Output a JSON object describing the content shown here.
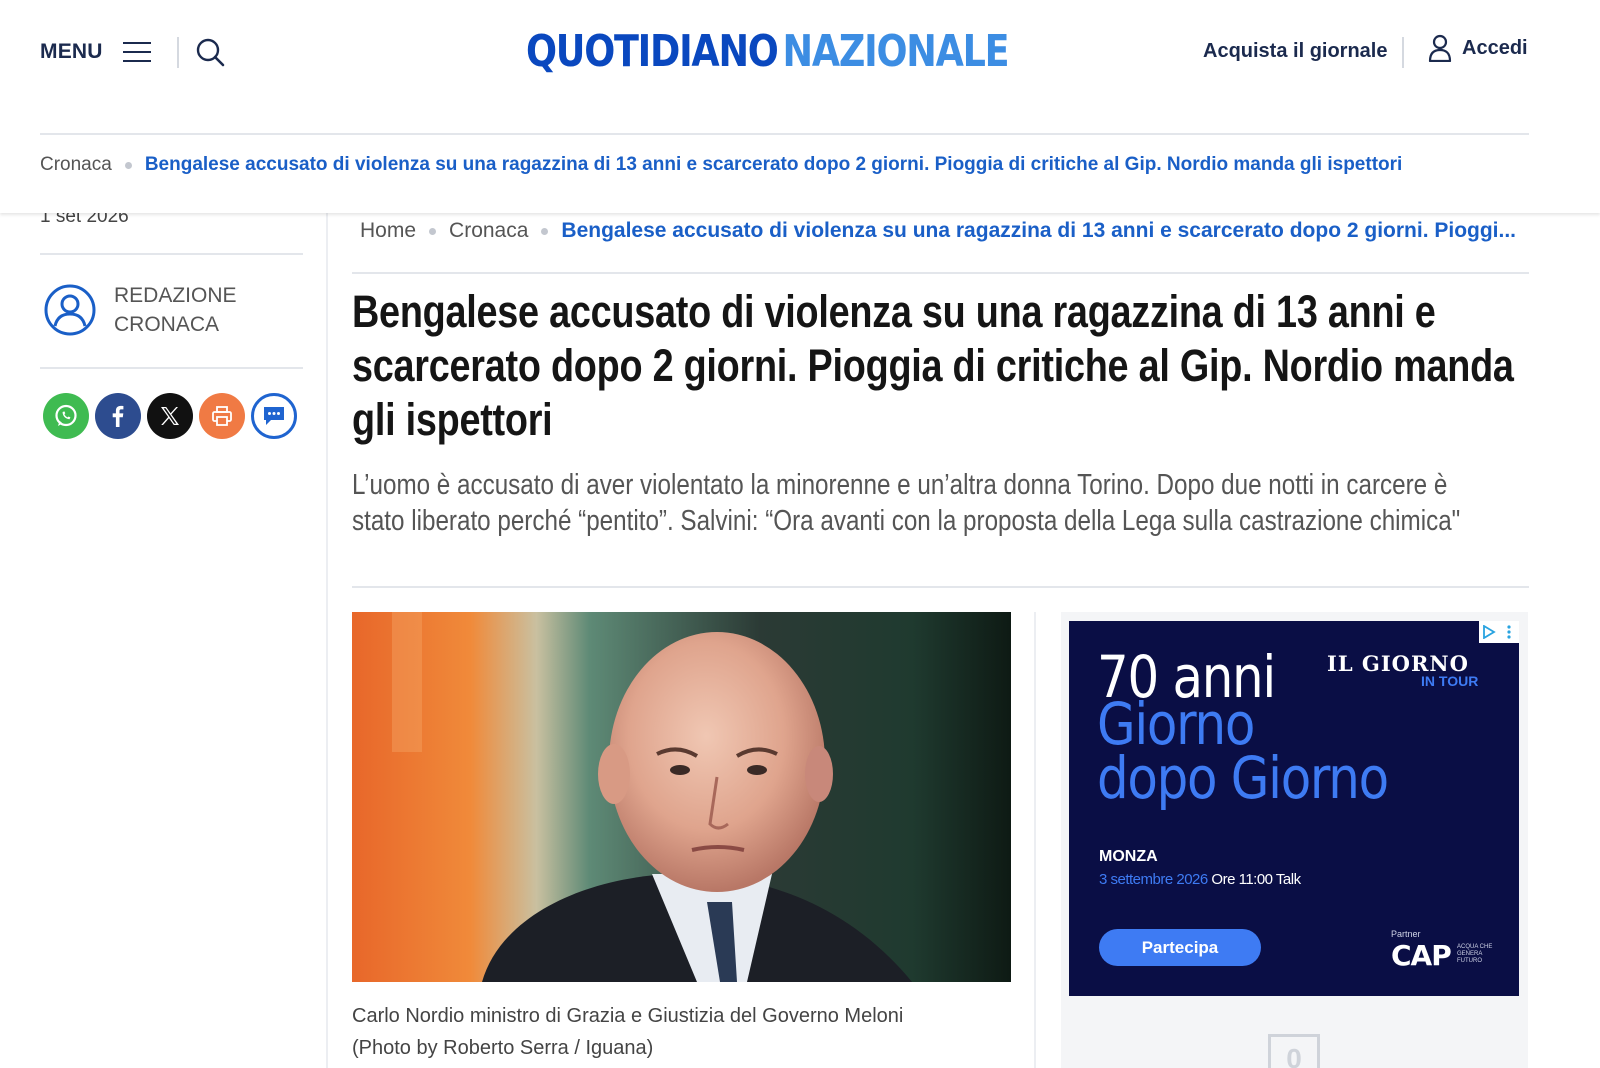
{
  "header": {
    "menu_label": "MENU",
    "logo_part1": "QUOTIDIANO",
    "logo_part2": "NAZIONALE",
    "buy_label": "Acquista il giornale",
    "login_label": "Accedi"
  },
  "sticky_breadcrumb": {
    "section": "Cronaca",
    "title": "Bengalese accusato di violenza su una ragazzina di 13 anni e scarcerato dopo 2 giorni. Pioggia di critiche al Gip. Nordio manda gli ispettori"
  },
  "sidebar": {
    "date": "1 set 2026",
    "author": "REDAZIONE CRONACA",
    "share_buttons": [
      "whatsapp-icon",
      "facebook-icon",
      "x-icon",
      "print-icon",
      "comment-icon"
    ],
    "share_colors": [
      "#3fbb51",
      "#2d4c8f",
      "#111111",
      "#f07a44",
      "#1f64d0"
    ]
  },
  "breadcrumb": {
    "home": "Home",
    "section": "Cronaca",
    "current": "Bengalese accusato di violenza su una ragazzina di 13 anni e scarcerato dopo 2 giorni. Pioggi..."
  },
  "article": {
    "headline": "Bengalese accusato di violenza su una ragazzina di 13 anni e scarcerato dopo 2 giorni. Pioggia di critiche al Gip. Nordio manda gli ispettori",
    "subtitle": "L’uomo è accusato di aver violentato la minorenne e un’altra donna Torino. Dopo due notti in carcere è stato liberato perché “pentito”. Salvini: “Ora avanti con la proposta della Lega sulla castrazione chimica\"",
    "caption_line1": "Carlo Nordio ministro di Grazia e Giustizia del Governo Meloni",
    "caption_line2": "(Photo by Roberto Serra / Iguana)"
  },
  "ad": {
    "headline1": "70 anni",
    "headline2a": "Giorno",
    "headline2b": "dopo Giorno",
    "brand": "IL GIORNO",
    "tour": "IN TOUR",
    "city": "MONZA",
    "date": "3 settembre 2026",
    "time": "Ore 11:00 Talk",
    "cta": "Partecipa",
    "partner_label": "Partner",
    "partner_name": "CAP",
    "partner_tagline": "ACQUA CHE GENERA FUTURO"
  },
  "comments": {
    "count": "0"
  },
  "colors": {
    "brand_dark": "#0a48bf",
    "brand_light": "#3c8de3",
    "link": "#1a5fc7",
    "ad_bg": "#0a0e45",
    "ad_accent": "#3e7bf3"
  }
}
